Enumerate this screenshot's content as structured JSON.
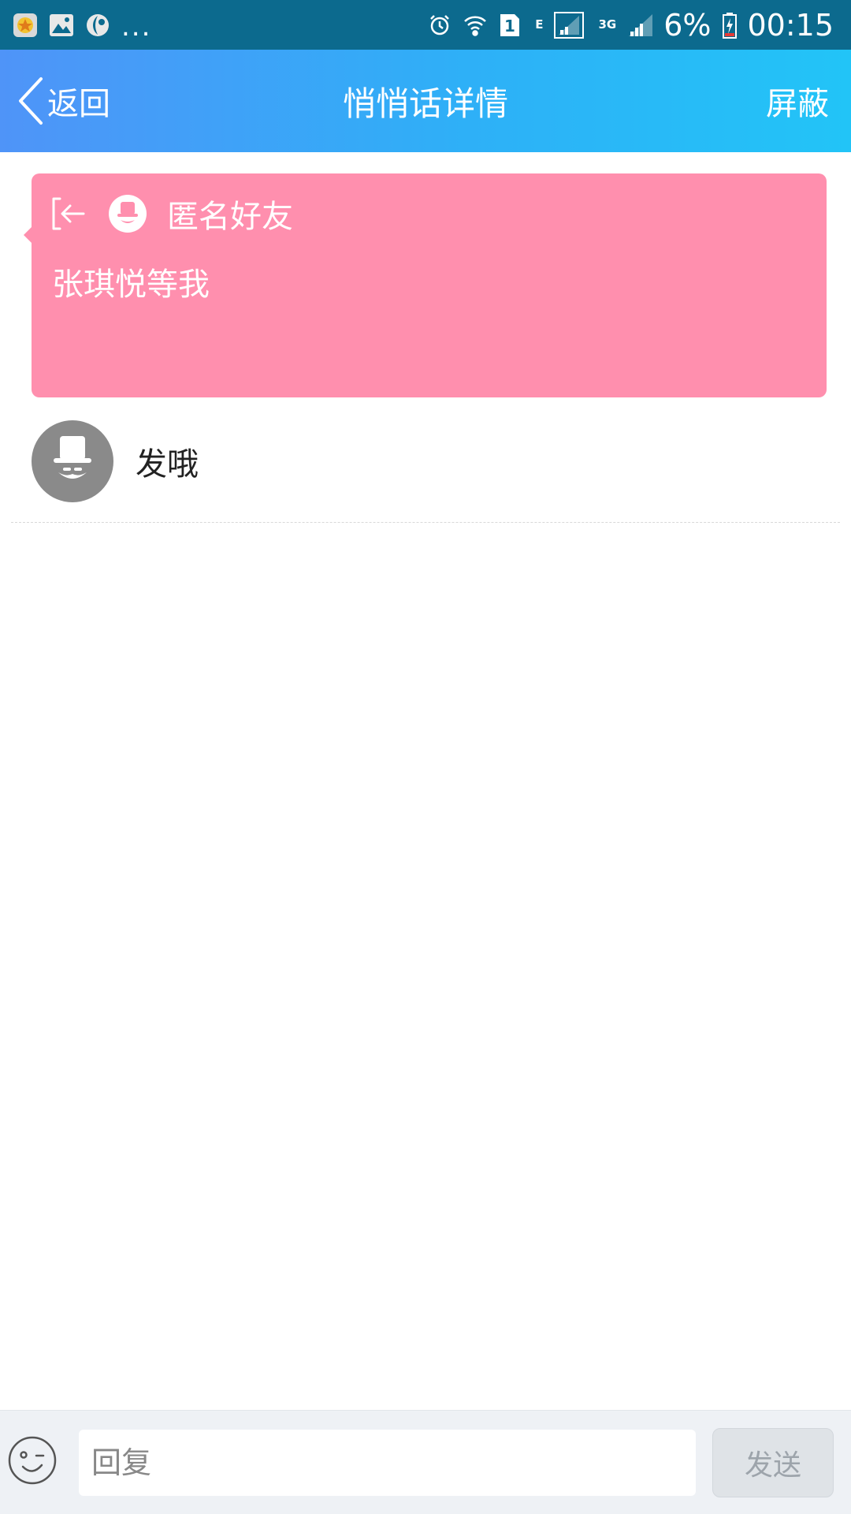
{
  "status_bar": {
    "overflow_indicator": "...",
    "sim_slot": "1",
    "network_e": "E",
    "network_3g": "3G",
    "battery_percent": "6%",
    "time": "00:15",
    "icons": [
      "app-notification-icon",
      "gallery-icon",
      "app-icon",
      "alarm-icon",
      "wifi-icon",
      "sim-icon",
      "signal-icon",
      "signal-3g-icon",
      "battery-charging-icon"
    ]
  },
  "nav": {
    "back_label": "返回",
    "title": "悄悄话详情",
    "block_label": "屏蔽"
  },
  "whisper": {
    "sender_name": "匿名好友",
    "message": "张琪悦等我",
    "card_color": "#ff8fae"
  },
  "reply": {
    "text": "发哦"
  },
  "input_bar": {
    "placeholder": "回复",
    "send_label": "发送"
  },
  "colors": {
    "status_bar": "#0c6a8e",
    "nav_gradient_start": "#4f94f8",
    "nav_gradient_end": "#22c4f7"
  }
}
